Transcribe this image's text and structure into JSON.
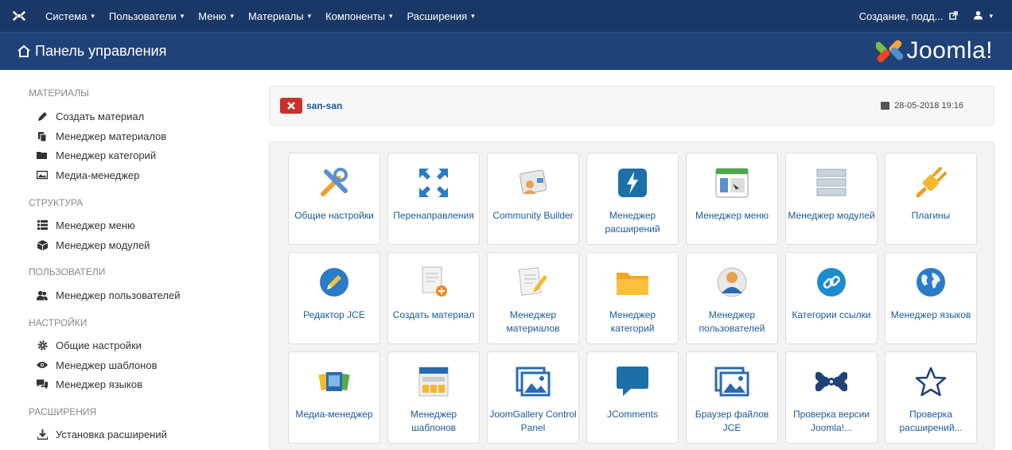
{
  "topnav": {
    "items": [
      {
        "label": "Система"
      },
      {
        "label": "Пользователи"
      },
      {
        "label": "Меню"
      },
      {
        "label": "Материалы"
      },
      {
        "label": "Компоненты"
      },
      {
        "label": "Расширения"
      }
    ],
    "user_label": "Создание, подд..."
  },
  "header": {
    "title": "Панель управления",
    "logo_text": "Joomla!"
  },
  "sidebar": {
    "sections": [
      {
        "title": "МАТЕРИАЛЫ",
        "items": [
          {
            "label": "Создать материал",
            "icon": "pencil-icon"
          },
          {
            "label": "Менеджер материалов",
            "icon": "copy-icon"
          },
          {
            "label": "Менеджер категорий",
            "icon": "folder-icon"
          },
          {
            "label": "Медиа-менеджер",
            "icon": "image-icon"
          }
        ]
      },
      {
        "title": "СТРУКТУРА",
        "items": [
          {
            "label": "Менеджер меню",
            "icon": "list-icon"
          },
          {
            "label": "Менеджер модулей",
            "icon": "cube-icon"
          }
        ]
      },
      {
        "title": "ПОЛЬЗОВАТЕЛИ",
        "items": [
          {
            "label": "Менеджер пользователей",
            "icon": "users-icon"
          }
        ]
      },
      {
        "title": "НАСТРОЙКИ",
        "items": [
          {
            "label": "Общие настройки",
            "icon": "gear-icon"
          },
          {
            "label": "Менеджер шаблонов",
            "icon": "eye-icon"
          },
          {
            "label": "Менеджер языков",
            "icon": "comments-icon"
          }
        ]
      },
      {
        "title": "РАСШИРЕНИЯ",
        "items": [
          {
            "label": "Установка расширений",
            "icon": "upload-icon"
          }
        ]
      }
    ]
  },
  "alert": {
    "username": "san-san",
    "datetime": "28-05-2018 19:16"
  },
  "tiles": [
    {
      "label": "Общие настройки",
      "icon": "tools-icon"
    },
    {
      "label": "Перенаправления",
      "icon": "redirect-arrows-icon"
    },
    {
      "label": "Community Builder",
      "icon": "contact-card-icon"
    },
    {
      "label": "Менеджер расширений",
      "icon": "lightning-icon"
    },
    {
      "label": "Менеджер меню",
      "icon": "window-menu-icon"
    },
    {
      "label": "Менеджер модулей",
      "icon": "modules-stack-icon"
    },
    {
      "label": "Плагины",
      "icon": "plug-icon"
    },
    {
      "label": "Редактор JCE",
      "icon": "pencil-circle-icon"
    },
    {
      "label": "Создать материал",
      "icon": "new-document-icon"
    },
    {
      "label": "Менеджер материалов",
      "icon": "edit-document-icon"
    },
    {
      "label": "Менеджер категорий",
      "icon": "folder-icon"
    },
    {
      "label": "Менеджер пользователей",
      "icon": "user-icon"
    },
    {
      "label": "Категории ссылки",
      "icon": "link-icon"
    },
    {
      "label": "Менеджер языков",
      "icon": "globe-icon"
    },
    {
      "label": "Медиа-менеджер",
      "icon": "media-icon"
    },
    {
      "label": "Менеджер шаблонов",
      "icon": "template-icon"
    },
    {
      "label": "JoomGallery Control Panel",
      "icon": "gallery-icon"
    },
    {
      "label": "JComments",
      "icon": "speech-bubble-icon"
    },
    {
      "label": "Браузер файлов JCE",
      "icon": "image-browser-icon"
    },
    {
      "label": "Проверка версии Joomla!...",
      "icon": "joomla-icon"
    },
    {
      "label": "Проверка расширений...",
      "icon": "star-icon"
    }
  ],
  "colors": {
    "topbar": "#1a3867",
    "header": "#1f4278",
    "link": "#1a5a98",
    "alert_red": "#c9302c"
  }
}
